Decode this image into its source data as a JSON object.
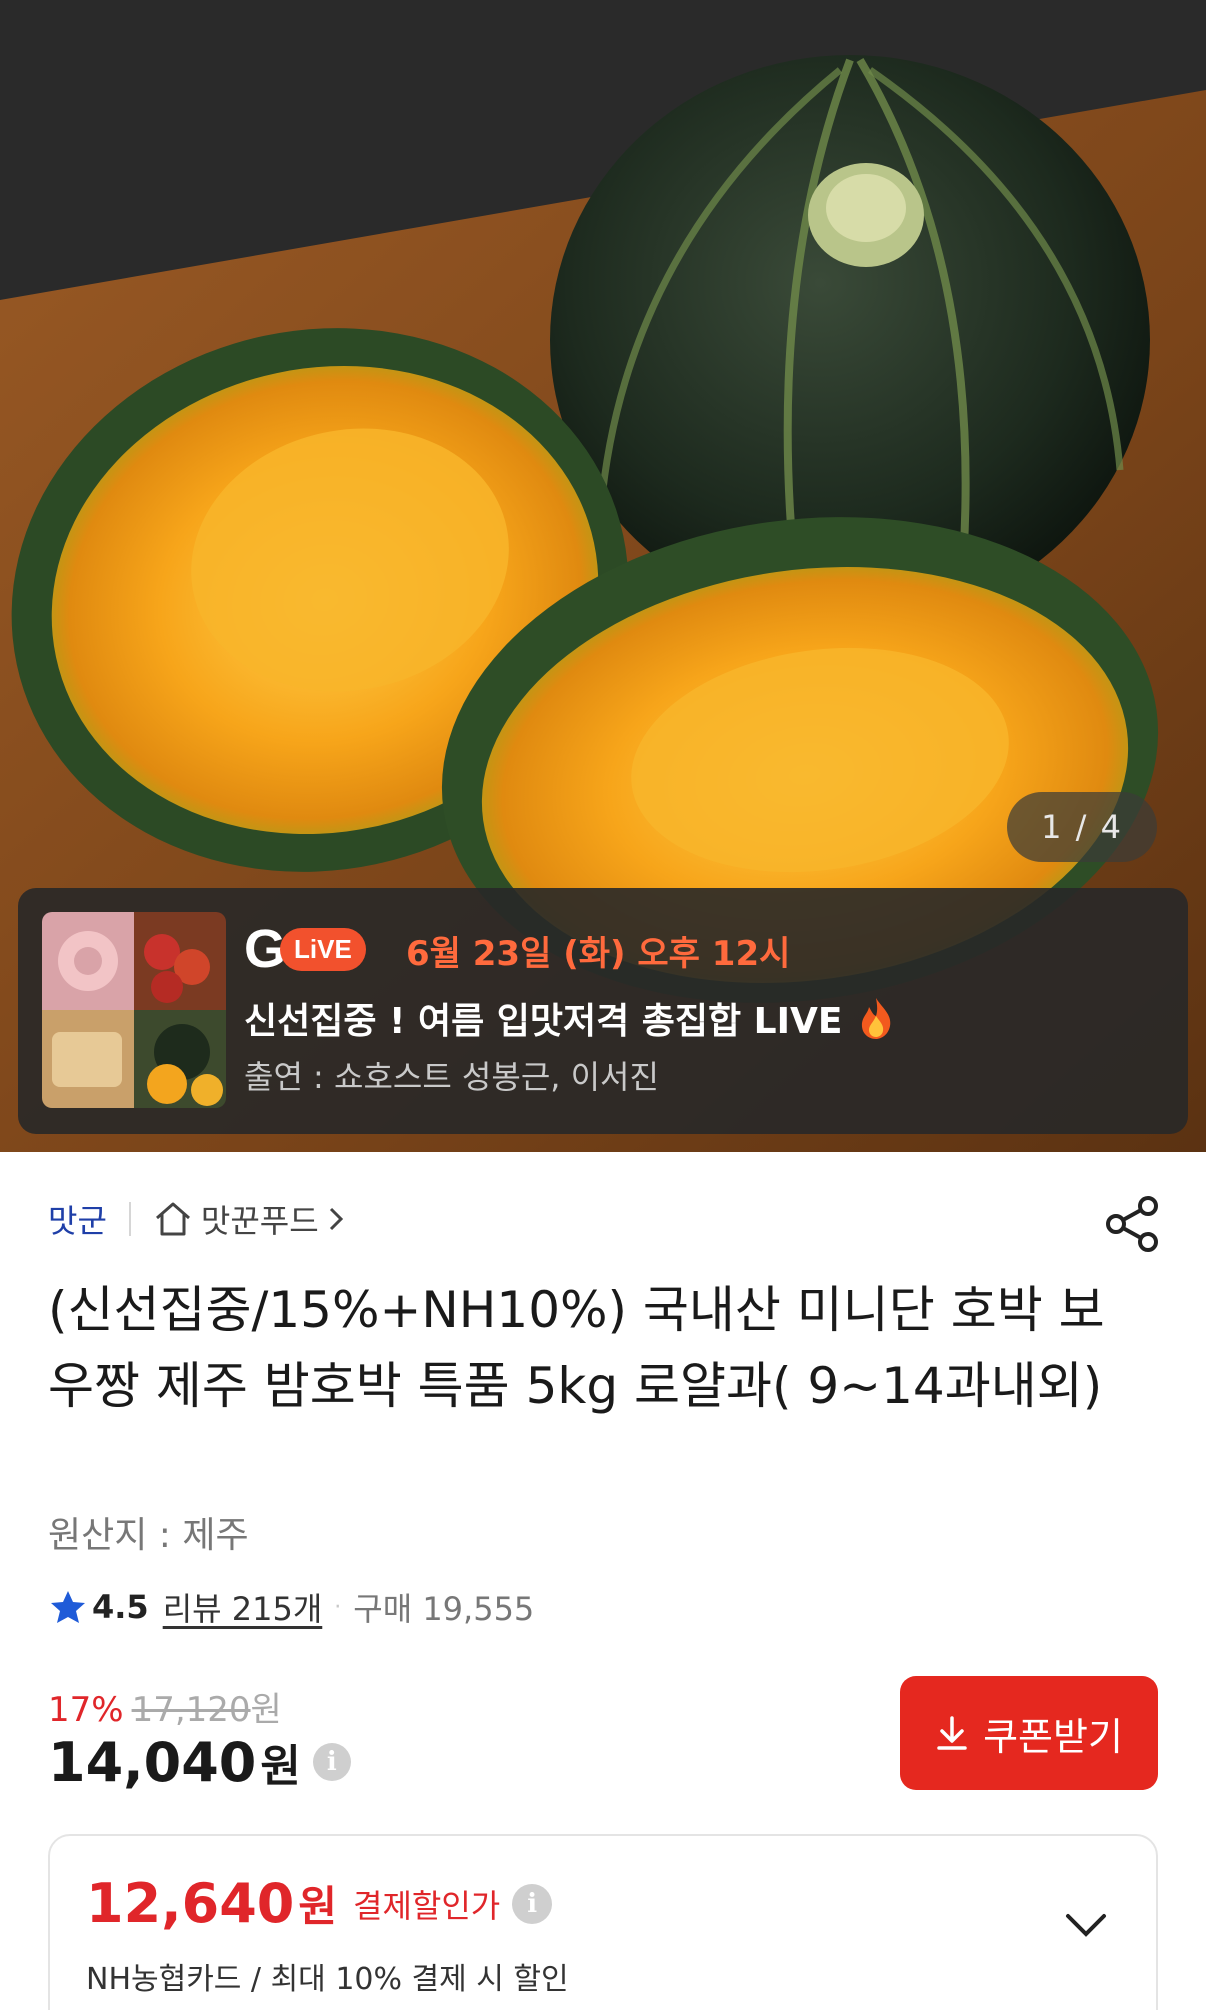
{
  "gallery": {
    "counter": "1 / 4"
  },
  "live_banner": {
    "logo_g": "G",
    "logo_live": "LiVE",
    "date": "6월 23일 (화) 오후 12시",
    "title": "신선집중 ! 여름 입맛저격 총집합 LIVE",
    "title_icon": "fire-icon",
    "cast": "출연 : 쇼호스트 성봉근, 이서진"
  },
  "seller": {
    "brand": "맛군",
    "store": "맛꾼푸드",
    "store_icon": "home-icon",
    "share_icon": "share-icon"
  },
  "product": {
    "title": "(신선집중/15%+NH10%) 국내산 미니단 호박 보우짱 제주 밤호박 특품 5kg 로얄과( 9~14과내외)",
    "origin": "원산지 : 제주"
  },
  "rating": {
    "score": "4.5",
    "reviews": "리뷰 215개",
    "separator": "·",
    "purchases": "구매 19,555"
  },
  "pricing": {
    "discount_rate": "17%",
    "original_price": "17,120",
    "original_won": "원",
    "price": "14,040",
    "price_won": "원",
    "info_icon": "i",
    "coupon_label": "쿠폰받기"
  },
  "card_offer": {
    "price": "12,640",
    "won": "원",
    "label": "결제할인가",
    "info_icon": "i",
    "description": "NH농협카드 / 최대 10% 결제 시 할인"
  },
  "colors": {
    "accent_red": "#e0262a",
    "coupon_bg": "#e5281f",
    "brand_blue": "#1f3fa8",
    "live_orange": "#ff6a3d"
  }
}
